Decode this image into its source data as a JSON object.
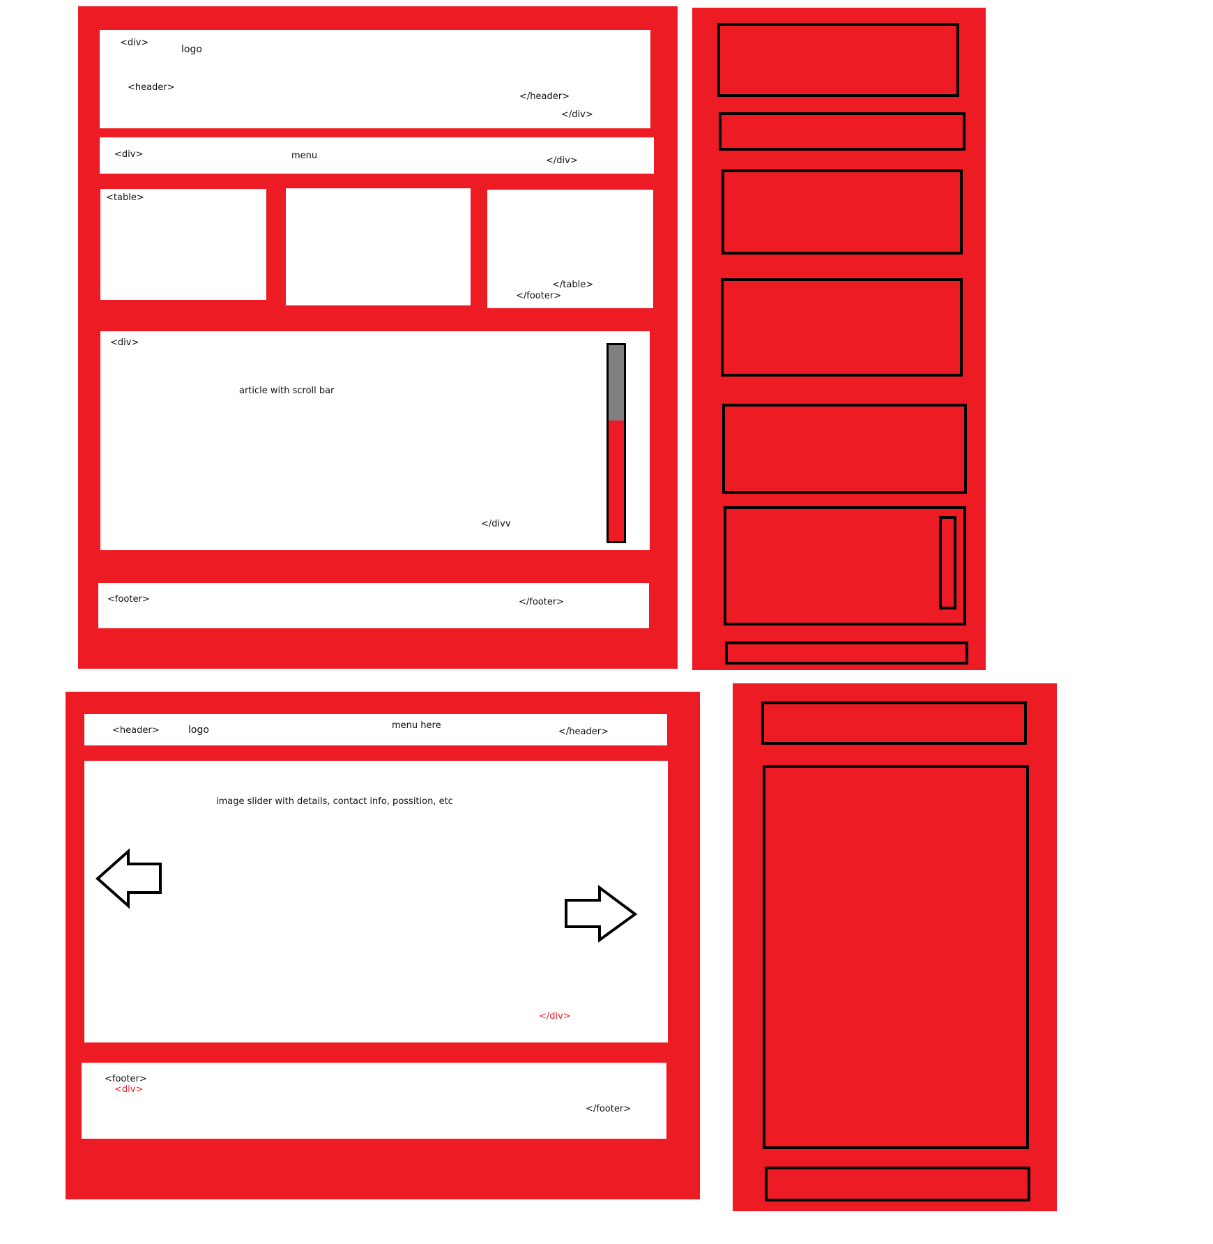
{
  "colors": {
    "panel_red": "#ed1c24",
    "box_white": "#ffffff",
    "outline_black": "#000000",
    "scroll_thumb_gray": "#808080"
  },
  "desktop": {
    "header": {
      "open_div": "<div>",
      "logo": "logo",
      "open_header": "<header>",
      "close_header": "</header>",
      "close_div": "</div>"
    },
    "menu": {
      "open_div": "<div>",
      "label": "menu",
      "close_div": "</div>"
    },
    "table": {
      "open_table": "<table>",
      "close_table": "</table>",
      "close_footer": "</footer>"
    },
    "article": {
      "open_div": "<div>",
      "label": "article with scroll bar",
      "close_div": "</divv"
    },
    "footer": {
      "open_footer": "<footer>",
      "close_footer": "</footer>"
    }
  },
  "mobile_desktop_layout": {
    "icon": "mobile-wireframe-1"
  },
  "landing": {
    "header": {
      "open_header": "<header>",
      "logo": "logo",
      "menu": "menu here",
      "close_header": "</header>"
    },
    "slider": {
      "label": "image slider with details, contact info, possition, etc",
      "close_div": "</div>",
      "prev_icon": "arrow-left-icon",
      "next_icon": "arrow-right-icon"
    },
    "footer": {
      "open_footer": "<footer>",
      "open_div": "<div>",
      "close_footer": "</footer>"
    }
  },
  "mobile_landing_layout": {
    "icon": "mobile-wireframe-2"
  }
}
